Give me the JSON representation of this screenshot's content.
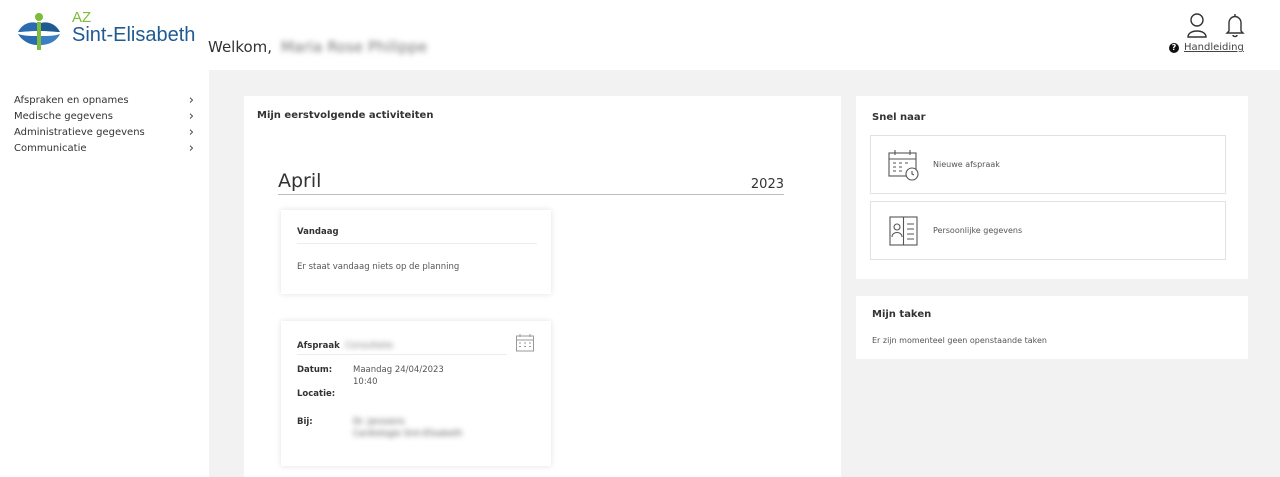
{
  "header": {
    "logo_az": "AZ",
    "logo_name": "Sint-Elisabeth",
    "welcome": "Welkom,",
    "user_name": "Maria Rose Philippe",
    "help_label": "Handleiding"
  },
  "sidebar": {
    "items": [
      {
        "label": "Afspraken en opnames"
      },
      {
        "label": "Medische gegevens"
      },
      {
        "label": "Administratieve gegevens"
      },
      {
        "label": "Communicatie"
      }
    ],
    "chevron": "›"
  },
  "activities": {
    "title": "Mijn eerstvolgende activiteiten",
    "month": "April",
    "year": "2023",
    "today": {
      "label": "Vandaag",
      "message": "Er staat vandaag niets op de planning"
    },
    "appointment": {
      "label": "Afspraak",
      "label_value": "Consultatie",
      "date_key": "Datum:",
      "date_value": "Maandag 24/04/2023",
      "time_value": "10:40",
      "location_key": "Locatie:",
      "with_key": "Bij:",
      "with_value_1": "Dr. Janssens",
      "with_value_2": "Cardiologie Sint-Elisabeth"
    }
  },
  "quick_links": {
    "title": "Snel naar",
    "items": [
      {
        "label": "Nieuwe afspraak",
        "icon": "calendar-clock-icon"
      },
      {
        "label": "Persoonlijke gegevens",
        "icon": "id-card-icon"
      }
    ]
  },
  "tasks": {
    "title": "Mijn taken",
    "message": "Er zijn momenteel geen openstaande taken"
  },
  "colors": {
    "brand_blue": "#1f5a93",
    "brand_green": "#7dbb3a",
    "background_grey": "#f2f2f2"
  }
}
